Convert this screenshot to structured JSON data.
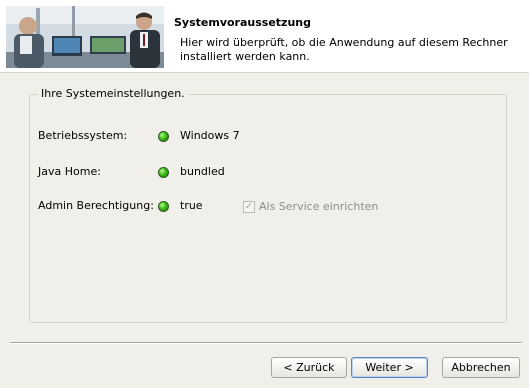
{
  "header": {
    "title": "Systemvoraussetzung",
    "description": "Hier wird überprüft, ob die Anwendung auf diesem Rechner installiert werden kann."
  },
  "group": {
    "legend": "Ihre Systemeinstellungen.",
    "rows": [
      {
        "label": "Betriebssystem:",
        "status": "green",
        "value": "Windows 7"
      },
      {
        "label": "Java Home:",
        "status": "green",
        "value": "bundled"
      },
      {
        "label": "Admin Berechtigung:",
        "status": "green",
        "value": "true"
      }
    ],
    "service_checkbox": {
      "label": "Als Service einrichten",
      "checked": true,
      "enabled": false
    }
  },
  "buttons": {
    "back": "< Zurück",
    "next": "Weiter >",
    "cancel": "Abbrechen"
  },
  "colors": {
    "status_green": "#44c21c",
    "panel_background": "#f0efe9"
  }
}
